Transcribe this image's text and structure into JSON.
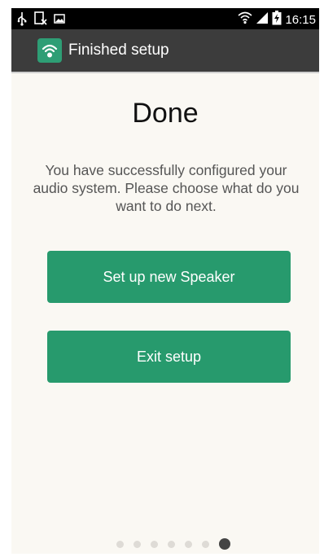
{
  "status_bar": {
    "time": "16:15",
    "left_icons": [
      "usb-icon",
      "no-sim-icon",
      "image-icon"
    ],
    "right_icons": [
      "wifi-icon",
      "signal-icon",
      "battery-charging-icon"
    ]
  },
  "action_bar": {
    "title": "Finished setup",
    "app_icon": "speaker-wifi-app-icon"
  },
  "main": {
    "title": "Done",
    "message": "You have successfully configured your audio system. Please choose what do you want to do next.",
    "buttons": {
      "setup_new": "Set up new Speaker",
      "exit": "Exit setup"
    }
  },
  "pager": {
    "total": 7,
    "active_index": 6
  },
  "colors": {
    "accent": "#279a6d",
    "action_bar": "#3c3c3c",
    "background": "#faf8f3"
  }
}
